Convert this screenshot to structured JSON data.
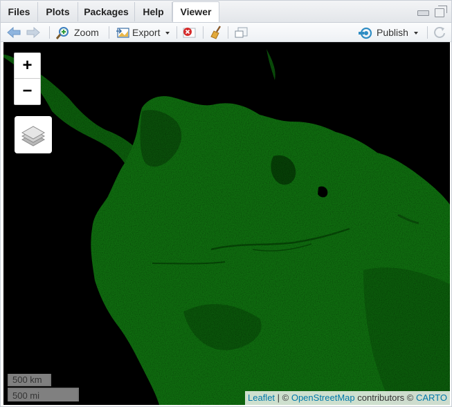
{
  "tabs": [
    {
      "label": "Files",
      "active": false
    },
    {
      "label": "Plots",
      "active": false
    },
    {
      "label": "Packages",
      "active": false
    },
    {
      "label": "Help",
      "active": false
    },
    {
      "label": "Viewer",
      "active": true
    }
  ],
  "toolbar": {
    "zoom_label": "Zoom",
    "export_label": "Export",
    "publish_label": "Publish"
  },
  "map": {
    "zoom_in": "+",
    "zoom_out": "−",
    "scale_km": "500 km",
    "scale_mi": "500 mi",
    "attribution": {
      "leaflet": "Leaflet",
      "sep1": " | © ",
      "osm": "OpenStreetMap",
      "contrib": " contributors © ",
      "carto": "CARTO"
    },
    "colors": {
      "land": "#0f6b0f",
      "background": "#000000",
      "link": "#0078a8"
    }
  }
}
